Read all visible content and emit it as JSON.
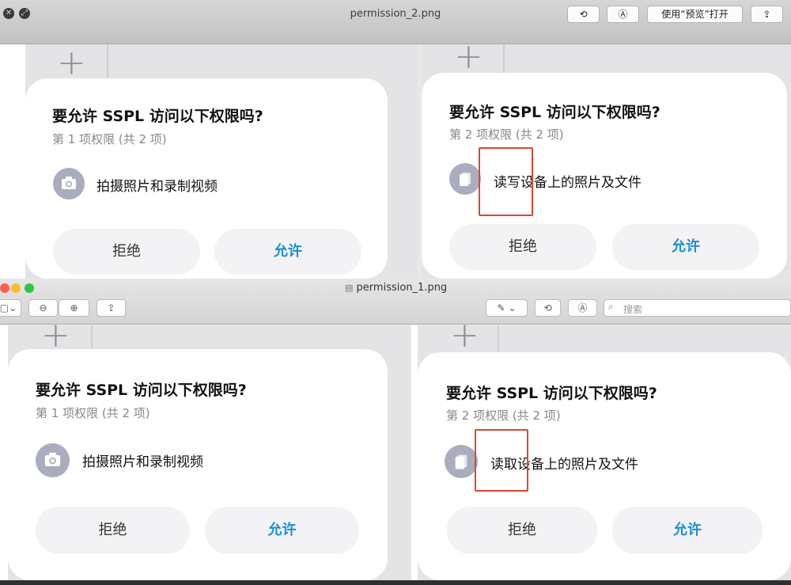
{
  "quicklook": {
    "file_name": "permission_2.png",
    "open_with_label": "使用“预览”打开"
  },
  "preview": {
    "file_name": "permission_1.png",
    "search_placeholder": "搜索"
  },
  "dialogs": {
    "top_left": {
      "title": "要允许 SSPL 访问以下权限吗?",
      "subtitle": "第 1 项权限 (共 2 项)",
      "permission": "拍摄照片和录制视频",
      "deny": "拒绝",
      "allow": "允许"
    },
    "top_right": {
      "title": "要允许 SSPL 访问以下权限吗?",
      "subtitle": "第 2 项权限 (共 2 项)",
      "permission": "读写设备上的照片及文件",
      "deny": "拒绝",
      "allow": "允许"
    },
    "bottom_left": {
      "title": "要允许 SSPL 访问以下权限吗?",
      "subtitle": "第 1 项权限 (共 2 项)",
      "permission": "拍摄照片和录制视频",
      "deny": "拒绝",
      "allow": "允许"
    },
    "bottom_right": {
      "title": "要允许 SSPL 访问以下权限吗?",
      "subtitle": "第 2 项权限 (共 2 项)",
      "permission": "读取设备上的照片及文件",
      "deny": "拒绝",
      "allow": "允许"
    }
  },
  "colors": {
    "allow_text": "#1a8fd8",
    "highlight_box": "#e2462d",
    "icon_bg": "#a9adbd"
  },
  "icons": [
    "close-icon",
    "fullscreen-icon",
    "rotate-icon",
    "markup-icon",
    "share-icon",
    "sidebar-icon",
    "zoom-out-icon",
    "zoom-in-icon",
    "pen-icon",
    "search-icon",
    "camera-icon",
    "files-icon",
    "plus-icon"
  ]
}
